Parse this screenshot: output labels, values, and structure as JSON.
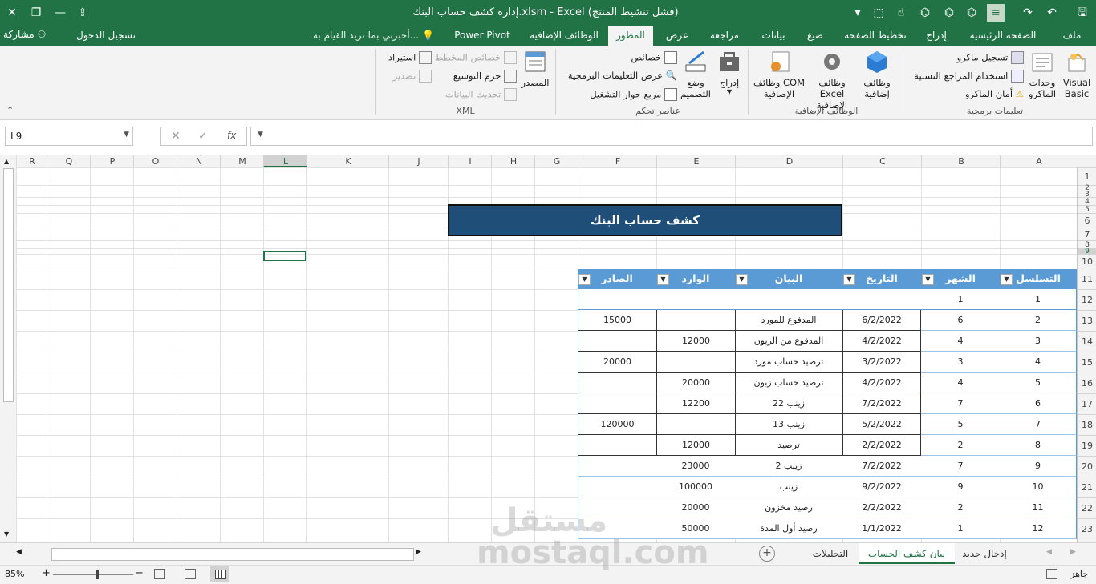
{
  "title": "إدارة كشف حساب البنك.xlsm - Excel (فشل تنشيط المنتج)",
  "tabs": [
    "ملف",
    "الصفحة الرئيسية",
    "إدراج",
    "تخطيط الصفحة",
    "صيغ",
    "بيانات",
    "مراجعة",
    "عرض",
    "المطور",
    "الوظائف الإضافية",
    "Power Pivot"
  ],
  "active_tab": "المطور",
  "tell_me": "أخبرني بما تريد القيام به...",
  "sign_in": "تسجيل الدخول",
  "share": "مشاركة",
  "ribbon": {
    "code": {
      "label": "تعليمات برمجية",
      "visual_basic": "Visual Basic",
      "macros": "وحدات الماكرو",
      "record_macro": "تسجيل ماكرو",
      "relative_refs": "استخدام المراجع النسبية",
      "macro_security": "أمان الماكرو"
    },
    "addins": {
      "label": "الوظائف الإضافية",
      "addins": "وظائف إضافية",
      "excel_addins": "وظائف Excel الإضافية",
      "com_addins": "وظائف COM الإضافية"
    },
    "controls": {
      "label": "عناصر تحكم",
      "insert": "إدراج",
      "design_mode": "وضع التصميم",
      "properties": "خصائص",
      "view_code": "عرض التعليمات البرمجية",
      "run_dialog": "مربع حوار التشغيل"
    },
    "xml": {
      "label": "XML",
      "source": "المصدر",
      "map_props": "خصائص المخطط",
      "expansion_packs": "حزم التوسيع",
      "refresh_data": "تحديث البيانات",
      "import": "استيراد",
      "export": "تصدير"
    }
  },
  "name_box": "L9",
  "fx": "fx",
  "columns": [
    "A",
    "B",
    "C",
    "D",
    "E",
    "F",
    "G",
    "H",
    "I",
    "J",
    "K",
    "L",
    "M",
    "N",
    "O",
    "P",
    "Q",
    "R"
  ],
  "rows": [
    "1",
    "2",
    "3",
    "4",
    "5",
    "6",
    "7",
    "8",
    "9",
    "10",
    "11",
    "12",
    "13",
    "14",
    "15",
    "16",
    "17",
    "18",
    "19",
    "20",
    "21",
    "22",
    "23"
  ],
  "sheet_title": "كشف حساب البنك",
  "table": {
    "headers": [
      "التسلسل",
      "الشهر",
      "التاريخ",
      "البيان",
      "الوارد",
      "الصادر"
    ],
    "rows": [
      [
        "1",
        "1",
        "",
        "",
        "",
        ""
      ],
      [
        "2",
        "6",
        "6/2/2022",
        "المدفوع للمورد",
        "",
        "15000"
      ],
      [
        "3",
        "4",
        "4/2/2022",
        "المدفوع من الزبون",
        "12000",
        ""
      ],
      [
        "4",
        "3",
        "3/2/2022",
        "ترصيد حساب مورد",
        "",
        "20000"
      ],
      [
        "5",
        "4",
        "4/2/2022",
        "ترصيد حساب زبون",
        "20000",
        ""
      ],
      [
        "6",
        "7",
        "7/2/2022",
        "زينب 22",
        "12200",
        ""
      ],
      [
        "7",
        "5",
        "5/2/2022",
        "زينب 13",
        "",
        "120000"
      ],
      [
        "8",
        "2",
        "2/2/2022",
        "ترصيد",
        "12000",
        ""
      ],
      [
        "9",
        "7",
        "7/2/2022",
        "زينب 2",
        "23000",
        ""
      ],
      [
        "10",
        "9",
        "9/2/2022",
        "زينب",
        "100000",
        ""
      ],
      [
        "11",
        "2",
        "2/2/2022",
        "رصيد مخزون",
        "20000",
        ""
      ],
      [
        "12",
        "1",
        "1/1/2022",
        "رصيد أول المدة",
        "50000",
        ""
      ]
    ]
  },
  "sheet_tabs": [
    "إدخال جديد",
    "بيان كشف الحساب",
    "التحليلات"
  ],
  "active_sheet": "بيان كشف الحساب",
  "status": "جاهز",
  "zoom": "85%",
  "watermark": "مستقل mostaql.com"
}
